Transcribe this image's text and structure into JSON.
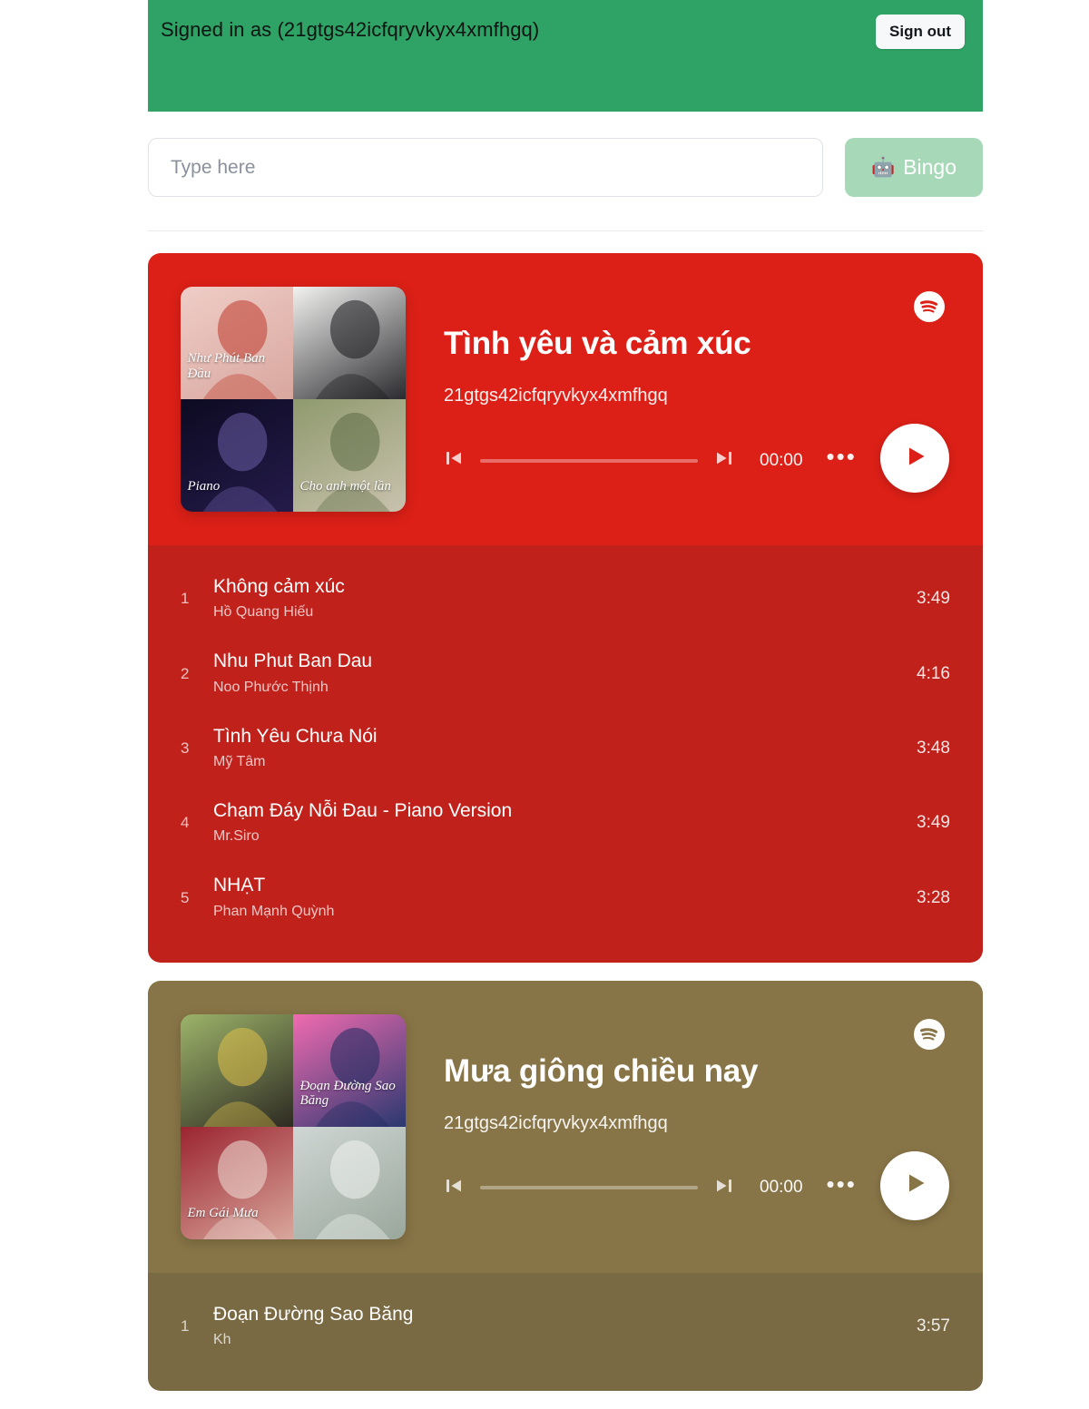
{
  "account": {
    "signed_in_text": "Signed in as (21gtgs42icfqryvkyx4xmfhgq)",
    "sign_out_label": "Sign out",
    "banner_color": "#2EA365"
  },
  "search": {
    "placeholder": "Type here",
    "value": "",
    "bingo_label": "Bingo",
    "bingo_emoji": "🤖",
    "bingo_color": "#a7d9b9"
  },
  "playlists": [
    {
      "title": "Tình yêu và cảm xúc",
      "owner": "21gtgs42icfqryvkyx4xmfhgq",
      "header_color": "#DC2017",
      "list_color": "#C0211B",
      "timecode": "00:00",
      "progress_percent": 0,
      "provider_icon": "spotify-icon",
      "art_tiles": [
        {
          "label": "Như Phút Ban Đầu",
          "c1": "#efcdc7",
          "c2": "#d8a79e",
          "accent": "#c0392b"
        },
        {
          "label": "",
          "c1": "#f2f2f0",
          "c2": "#2b2b2f",
          "accent": "#1a1a1d"
        },
        {
          "label": "Piano",
          "c1": "#0d0a22",
          "c2": "#241b4a",
          "accent": "#6b5ea8"
        },
        {
          "label": "Cho anh một lần",
          "c1": "#8f9a6d",
          "c2": "#c9c2ae",
          "accent": "#5c6b45"
        }
      ],
      "tracks": [
        {
          "num": "1",
          "title": "Không cảm xúc",
          "artist": "Hồ Quang Hiếu",
          "duration": "3:49"
        },
        {
          "num": "2",
          "title": "Nhu Phut Ban Dau",
          "artist": "Noo Phước Thịnh",
          "duration": "4:16"
        },
        {
          "num": "3",
          "title": "Tình Yêu Chưa Nói",
          "artist": "Mỹ Tâm",
          "duration": "3:48"
        },
        {
          "num": "4",
          "title": "Chạm Đáy Nỗi Đau - Piano Version",
          "artist": "Mr.Siro",
          "duration": "3:49"
        },
        {
          "num": "5",
          "title": "NHẠT",
          "artist": "Phan Mạnh Quỳnh",
          "duration": "3:28"
        }
      ]
    },
    {
      "title": "Mưa giông chiều nay",
      "owner": "21gtgs42icfqryvkyx4xmfhgq",
      "header_color": "#887547",
      "list_color": "#796A43",
      "timecode": "00:00",
      "progress_percent": 0,
      "provider_icon": "spotify-icon",
      "art_tiles": [
        {
          "label": "",
          "c1": "#9db46a",
          "c2": "#2d2a22",
          "accent": "#e0c14a"
        },
        {
          "label": "Đoạn Đường Sao Băng",
          "c1": "#f06bb0",
          "c2": "#2a3870",
          "accent": "#1d2a5e"
        },
        {
          "label": "Em Gái Mưa",
          "c1": "#9b2430",
          "c2": "#d9a79c",
          "accent": "#f0e0d8"
        },
        {
          "label": "",
          "c1": "#cfd6d4",
          "c2": "#9aa79c",
          "accent": "#f2f4f3"
        }
      ],
      "tracks": [
        {
          "num": "1",
          "title": "Đoạn Đường Sao Băng",
          "artist": "Kh",
          "duration": "3:57"
        }
      ]
    }
  ]
}
